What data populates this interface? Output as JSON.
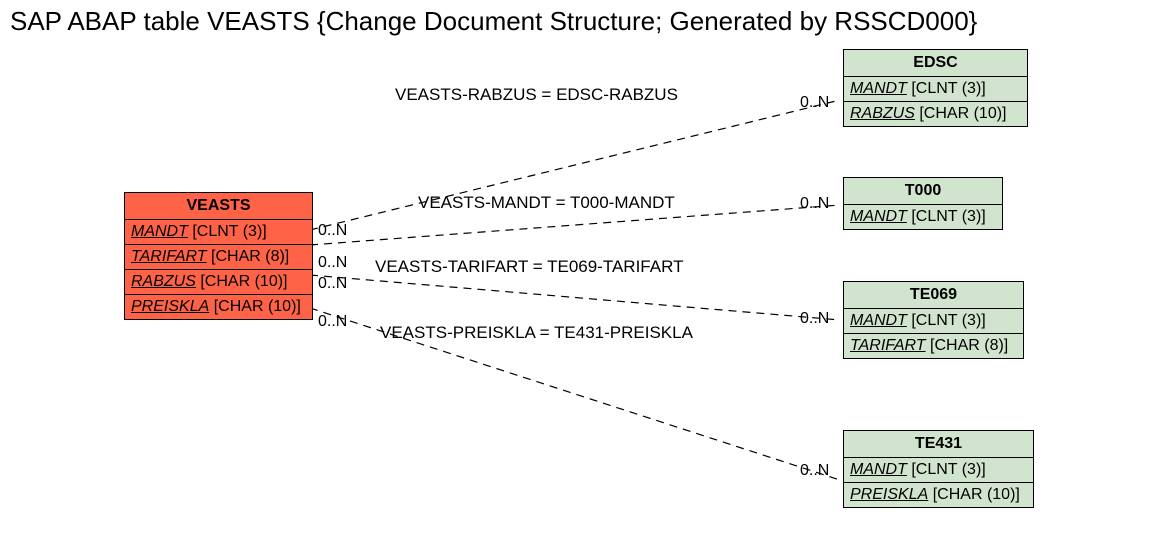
{
  "title": "SAP ABAP table VEASTS {Change Document Structure; Generated by RSSCD000}",
  "entities": {
    "veasts": {
      "name": "VEASTS",
      "fields": [
        {
          "fname": "MANDT",
          "type": "[CLNT (3)]"
        },
        {
          "fname": "TARIFART",
          "type": "[CHAR (8)]"
        },
        {
          "fname": "RABZUS",
          "type": "[CHAR (10)]"
        },
        {
          "fname": "PREISKLA",
          "type": "[CHAR (10)]"
        }
      ]
    },
    "edsc": {
      "name": "EDSC",
      "fields": [
        {
          "fname": "MANDT",
          "type": "[CLNT (3)]"
        },
        {
          "fname": "RABZUS",
          "type": "[CHAR (10)]"
        }
      ]
    },
    "t000": {
      "name": "T000",
      "fields": [
        {
          "fname": "MANDT",
          "type": "[CLNT (3)]"
        }
      ]
    },
    "te069": {
      "name": "TE069",
      "fields": [
        {
          "fname": "MANDT",
          "type": "[CLNT (3)]"
        },
        {
          "fname": "TARIFART",
          "type": "[CHAR (8)]"
        }
      ]
    },
    "te431": {
      "name": "TE431",
      "fields": [
        {
          "fname": "MANDT",
          "type": "[CLNT (3)]"
        },
        {
          "fname": "PREISKLA",
          "type": "[CHAR (10)]"
        }
      ]
    }
  },
  "links": {
    "l1": {
      "label": "VEASTS-RABZUS = EDSC-RABZUS",
      "left": "0..N",
      "right": "0..N"
    },
    "l2": {
      "label": "VEASTS-MANDT = T000-MANDT",
      "left": "0..N",
      "right": "0..N"
    },
    "l3": {
      "label": "VEASTS-TARIFART = TE069-TARIFART",
      "left": "0..N",
      "right": "0..N"
    },
    "l4": {
      "label": "VEASTS-PREISKLA = TE431-PREISKLA",
      "left": "0..N",
      "right": "0..N"
    }
  }
}
